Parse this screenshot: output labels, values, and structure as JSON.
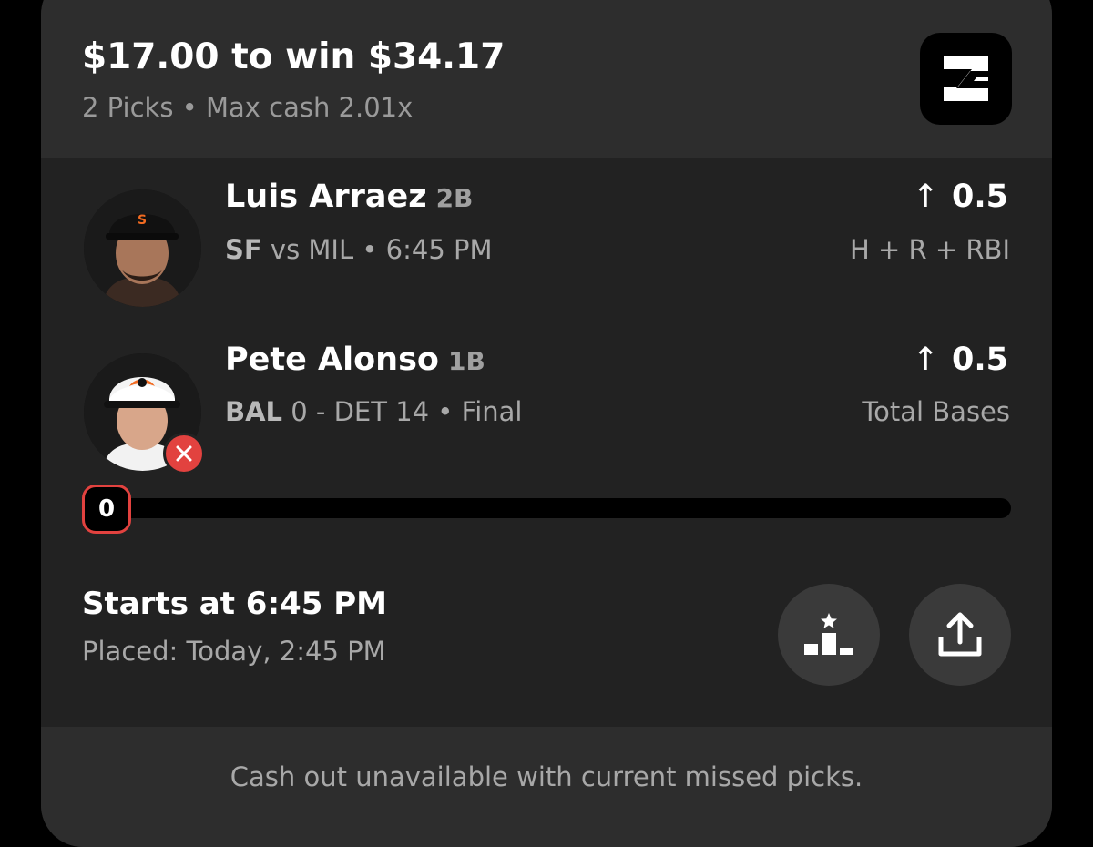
{
  "header": {
    "title": "$17.00 to win $34.17",
    "subtitle": "2 Picks • Max cash 2.01x",
    "logo_icon": "brand-logo-icon"
  },
  "picks": [
    {
      "name": "Luis Arraez",
      "position": "2B",
      "team": "SF",
      "game_detail": "vs MIL • 6:45 PM",
      "direction_icon": "arrow-up-icon",
      "arrow": "↑",
      "line": "0.5",
      "stat": "H + R + RBI"
    },
    {
      "name": "Pete Alonso",
      "position": "1B",
      "team": "BAL",
      "game_detail": "0 - DET 14 • Final",
      "direction_icon": "arrow-up-icon",
      "arrow": "↑",
      "line": "0.5",
      "stat": "Total Bases",
      "status": "missed",
      "progress_value": "0",
      "progress_fraction": 0.0
    }
  ],
  "status": {
    "starts": "Starts at 6:45 PM",
    "placed": "Placed: Today, 2:45 PM"
  },
  "actions": {
    "leaderboard_icon": "podium-icon",
    "share_icon": "share-icon"
  },
  "footer": {
    "message": "Cash out unavailable with current missed picks."
  },
  "colors": {
    "background": "#000000",
    "card": "#222222",
    "card_header": "#2d2d2d",
    "miss_red": "#e2423f",
    "button": "#3a3a3a"
  }
}
